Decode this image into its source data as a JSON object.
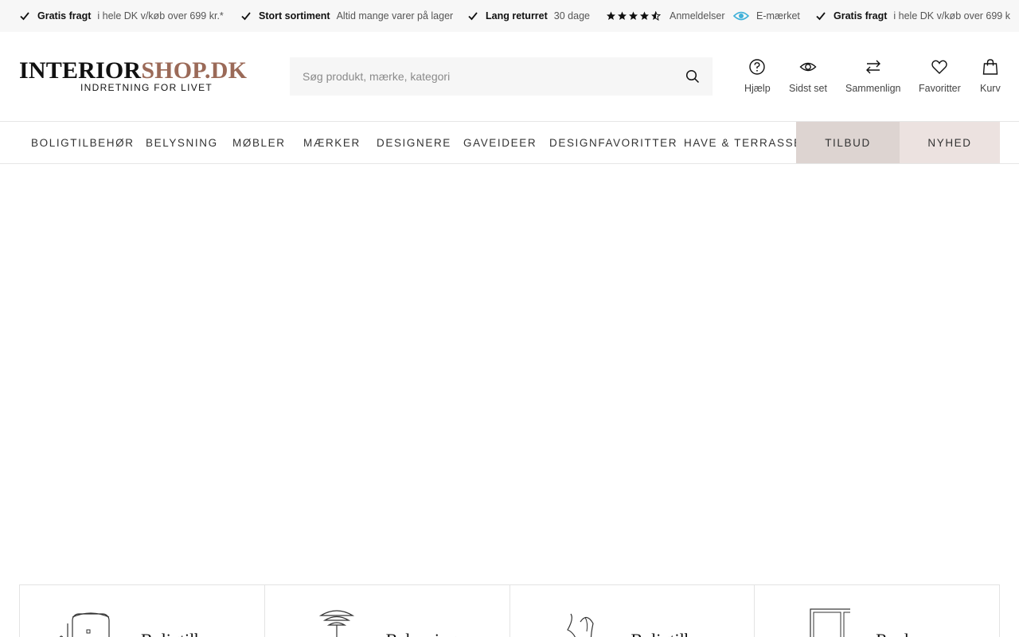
{
  "usp_bar": {
    "items": [
      {
        "bold": "Gratis fragt",
        "text": "i hele DK v/køb over 699 kr.*"
      },
      {
        "bold": "Stort sortiment",
        "text": "Altid mange varer på lager"
      },
      {
        "bold": "Lang returret",
        "text": "30 dage"
      }
    ],
    "reviews_label": "Anmeldelser",
    "emark_label": "E-mærket",
    "repeat": {
      "bold": "Gratis fragt",
      "text": "i hele DK v/køb over 699 k"
    },
    "rating_stars": 4.5
  },
  "header": {
    "logo_part1": "INTERIOR",
    "logo_part2": "SHOP.DK",
    "logo_tagline": "INDRETNING FOR LIVET",
    "search_placeholder": "Søg produkt, mærke, kategori",
    "actions": {
      "help": "Hjælp",
      "recent": "Sidst set",
      "compare": "Sammenlign",
      "favorites": "Favoritter",
      "cart": "Kurv"
    }
  },
  "nav": {
    "items": [
      "BOLIGTILBEHØR",
      "BELYSNING",
      "MØBLER",
      "MÆRKER",
      "DESIGNERE",
      "GAVEIDEER",
      "DESIGNFAVORITTER",
      "HAVE & TERRASSE",
      "TILBUD",
      "NYHED"
    ]
  },
  "categories": [
    {
      "title": "Boligtilbe",
      "icon": "kitchen-tools-icon"
    },
    {
      "title": "Belysning",
      "icon": "pendant-lamp-icon"
    },
    {
      "title": "Boligtilbe",
      "icon": "vase-icon"
    },
    {
      "title": "Reoler",
      "icon": "cabinet-icon"
    }
  ],
  "colors": {
    "accent": "#9b6a58",
    "tilbud_bg": "#ddd4d1",
    "nyhed_bg": "#ece2e0",
    "emark_blue": "#3fb0d9"
  }
}
